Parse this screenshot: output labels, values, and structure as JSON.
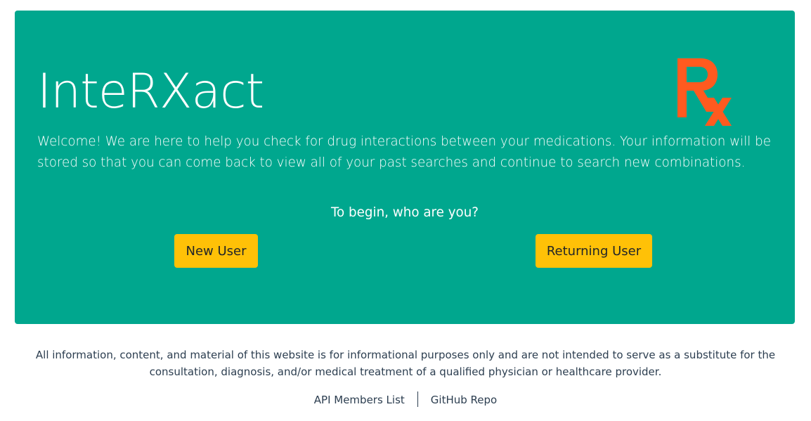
{
  "hero": {
    "title": "InteRXact",
    "welcome": "Welcome! We are here to help you check for drug interactions between your medications. Your information will be stored so that you can come back to view all of your past searches and continue to search new combinations.",
    "prompt": "To begin, who are you?",
    "logo_icon": "rx-prescription-icon",
    "background_color": "#00a78e",
    "logo_color": "#ff5a1f"
  },
  "buttons": {
    "new_user": "New User",
    "returning_user": "Returning User",
    "color": "#ffc107"
  },
  "footer": {
    "disclaimer": "All information, content, and material of this website is for informational purposes only and are not intended to serve as a substitute for the consultation, diagnosis, and/or medical treatment of a qualified physician or healthcare provider.",
    "links": [
      "API Members List",
      "GitHub Repo"
    ]
  }
}
